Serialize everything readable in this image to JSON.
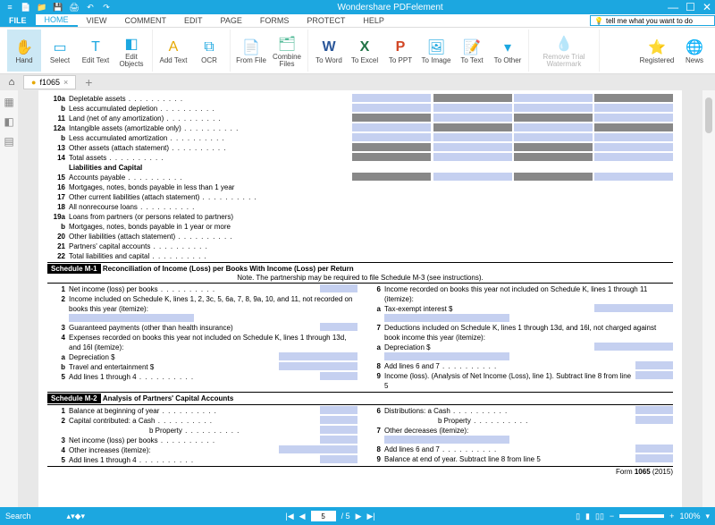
{
  "titlebar": {
    "title": "Wondershare PDFelement"
  },
  "menubar": {
    "file": "FILE",
    "tabs": [
      "HOME",
      "VIEW",
      "COMMENT",
      "EDIT",
      "PAGE",
      "FORMS",
      "PROTECT",
      "HELP"
    ],
    "search_placeholder": "tell me what you want to do"
  },
  "ribbon": {
    "hand": "Hand",
    "select": "Select",
    "edit_text": "Edit Text",
    "edit_objects": "Edit Objects",
    "add_text": "Add Text",
    "ocr": "OCR",
    "from_file": "From File",
    "combine": "Combine Files",
    "to_word": "To Word",
    "to_excel": "To Excel",
    "to_ppt": "To PPT",
    "to_image": "To Image",
    "to_text": "To Text",
    "to_other": "To Other",
    "watermark": "Remove Trial Watermark",
    "registered": "Registered",
    "news": "News"
  },
  "tabstrip": {
    "doc_name": "f1065"
  },
  "doc": {
    "lines": {
      "l10a": "Depletable assets",
      "l10b": "Less accumulated depletion",
      "l11": "Land (net of any amortization)",
      "l12a": "Intangible assets (amortizable only)",
      "l12b": "Less accumulated amortization",
      "l13": "Other assets (attach statement)",
      "l14": "Total assets",
      "liab_hdr": "Liabilities and Capital",
      "l15": "Accounts payable",
      "l16": "Mortgages, notes, bonds payable in less than 1 year",
      "l17": "Other current liabilities (attach statement)",
      "l18": "All nonrecourse loans",
      "l19a": "Loans from partners (or persons related to partners)",
      "l19b": "Mortgages, notes, bonds payable in 1 year or more",
      "l20": "Other liabilities (attach statement)",
      "l21": "Partners' capital accounts",
      "l22": "Total liabilities and capital"
    },
    "m1": {
      "hdr": "Schedule M-1",
      "title": "Reconciliation of Income (Loss) per Books With Income (Loss) per Return",
      "note": "Note. The partnership may be required to file Schedule M-3 (see instructions).",
      "l1": "Net income (loss) per books",
      "l2": "Income included on Schedule K, lines 1, 2, 3c, 5, 6a, 7, 8, 9a, 10, and 11, not recorded on books this year (itemize):",
      "l3": "Guaranteed payments (other than health insurance)",
      "l4": "Expenses recorded on books this year not included on Schedule K, lines 1 through 13d, and 16l (itemize):",
      "l4a": "Depreciation $",
      "l4b": "Travel and entertainment $",
      "l5": "Add lines 1 through 4",
      "r6": "Income recorded on books this year not included on Schedule K, lines 1 through 11 (itemize):",
      "r6a": "Tax-exempt interest $",
      "r7": "Deductions included on Schedule K, lines 1 through 13d, and 16l, not charged against book income this year (itemize):",
      "r7a": "Depreciation $",
      "r8": "Add lines 6 and 7",
      "r9": "Income (loss). (Analysis of Net Income (Loss), line 1). Subtract line 8 from line 5"
    },
    "m2": {
      "hdr": "Schedule M-2",
      "title": "Analysis of Partners' Capital Accounts",
      "l1": "Balance at beginning of year",
      "l2": "Capital contributed: a Cash",
      "l2b": "b Property",
      "l3": "Net income (loss) per books",
      "l4": "Other increases (itemize):",
      "l5": "Add lines 1 through 4",
      "r6": "Distributions: a Cash",
      "r6b": "b Property",
      "r7": "Other decreases (itemize):",
      "r8": "Add lines 6 and 7",
      "r9": "Balance at end of year. Subtract line 8 from line 5"
    },
    "form_footer": "Form 1065 (2015)"
  },
  "statusbar": {
    "search": "Search",
    "page_current": "5",
    "page_total": "/ 5",
    "zoom": "100%"
  }
}
